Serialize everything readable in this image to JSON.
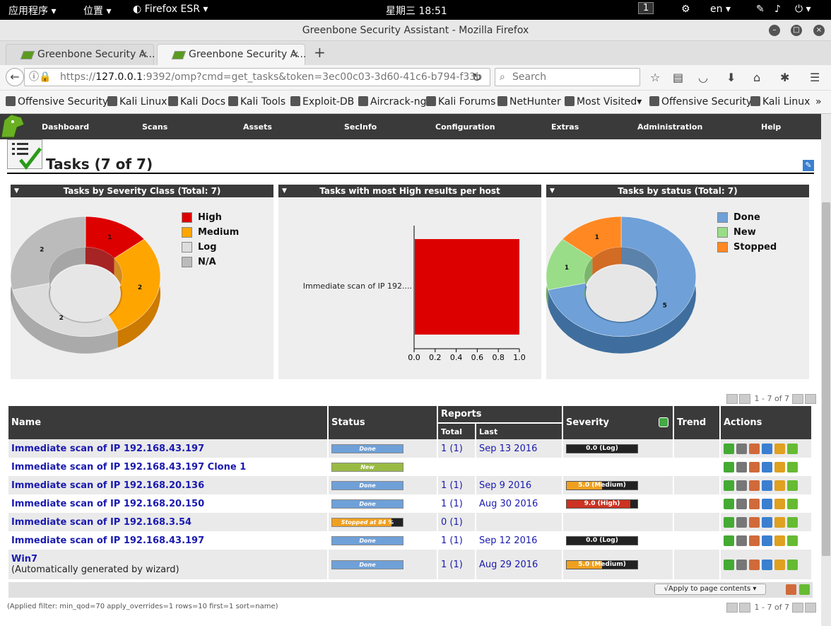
{
  "system": {
    "apps_label": "应用程序",
    "places_label": "位置",
    "browser_label": "Firefox ESR",
    "clock": "星期三 18:51",
    "workspace": "1",
    "lang": "en"
  },
  "window": {
    "title": "Greenbone Security Assistant - Mozilla Firefox"
  },
  "tabs": [
    {
      "label": "Greenbone Security A..."
    },
    {
      "label": "Greenbone Security A..."
    }
  ],
  "nav": {
    "url_prefix": "https://",
    "url_host": "127.0.0.1",
    "url_rest": ":9392/omp?cmd=get_tasks&token=3ec00c03-3d60-41c6-b794-f33b",
    "search_placeholder": "Search"
  },
  "bookmarks": [
    "Offensive Security",
    "Kali Linux",
    "Kali Docs",
    "Kali Tools",
    "Exploit-DB",
    "Aircrack-ng",
    "Kali Forums",
    "NetHunter",
    "Most Visited",
    "Offensive Security",
    "Kali Linux"
  ],
  "menu": [
    "Dashboard",
    "Scans",
    "Assets",
    "SecInfo",
    "Configuration",
    "Extras",
    "Administration",
    "Help"
  ],
  "page": {
    "title": "Tasks (7 of 7)"
  },
  "charts": {
    "severity": {
      "title": "Tasks by Severity Class (Total: 7)",
      "legend": [
        {
          "label": "High",
          "color": "#cc0000"
        },
        {
          "label": "Medium",
          "color": "#ffa500"
        },
        {
          "label": "Log",
          "color": "#dddddd"
        },
        {
          "label": "N/A",
          "color": "#bbbbbb"
        }
      ],
      "slices": [
        {
          "label": "High",
          "value": 1,
          "color": "#dd0000",
          "side": "#990000"
        },
        {
          "label": "Medium",
          "value": 2,
          "color": "#ffa500",
          "side": "#cc7a00"
        },
        {
          "label": "Log",
          "value": 2,
          "color": "#dddddd",
          "side": "#aaaaaa"
        },
        {
          "label": "N/A",
          "value": 2,
          "color": "#bbbbbb",
          "side": "#999999"
        }
      ]
    },
    "high_per_host": {
      "title": "Tasks with most High results per host",
      "bar_label": "Immediate scan of IP 192....",
      "value": 1,
      "ticks": [
        "0.0",
        "0.2",
        "0.4",
        "0.6",
        "0.8",
        "1.0"
      ],
      "color": "#dd0000"
    },
    "status": {
      "title": "Tasks by status (Total: 7)",
      "legend": [
        {
          "label": "Done",
          "color": "#6fa0d8"
        },
        {
          "label": "New",
          "color": "#99dd88"
        },
        {
          "label": "Stopped",
          "color": "#ff8822"
        }
      ],
      "slices": [
        {
          "label": "Done",
          "value": 5,
          "color": "#6fa0d8",
          "side": "#3f6e9e"
        },
        {
          "label": "New",
          "value": 1,
          "color": "#99dd88",
          "side": "#66aa55"
        },
        {
          "label": "Stopped",
          "value": 1,
          "color": "#ff8822",
          "side": "#cc5500"
        }
      ]
    }
  },
  "pager": {
    "text": "1 - 7 of 7"
  },
  "table": {
    "headers": {
      "name": "Name",
      "status": "Status",
      "reports": "Reports",
      "total": "Total",
      "last": "Last",
      "severity": "Severity",
      "trend": "Trend",
      "actions": "Actions"
    },
    "rows": [
      {
        "name": "Immediate scan of IP 192.168.43.197",
        "sub": "",
        "status": "Done",
        "status_color": "#6fa0d8",
        "progress": 1.0,
        "total": "1 (1)",
        "last": "Sep 13 2016",
        "severity": "0.0 (Log)",
        "sev_level": 0.0,
        "sev_color": "#222222"
      },
      {
        "name": "Immediate scan of IP 192.168.43.197 Clone 1",
        "sub": "",
        "status": "New",
        "status_color": "#99bb44",
        "progress": 1.0,
        "total": "",
        "last": "",
        "severity": "",
        "sev_level": 0,
        "sev_color": ""
      },
      {
        "name": "Immediate scan of IP 192.168.20.136",
        "sub": "",
        "status": "Done",
        "status_color": "#6fa0d8",
        "progress": 1.0,
        "total": "1 (1)",
        "last": "Sep 9 2016",
        "severity": "5.0 (Medium)",
        "sev_level": 0.5,
        "sev_color": "#f0a020"
      },
      {
        "name": "Immediate scan of IP 192.168.20.150",
        "sub": "",
        "status": "Done",
        "status_color": "#6fa0d8",
        "progress": 1.0,
        "total": "1 (1)",
        "last": "Aug 30 2016",
        "severity": "9.0 (High)",
        "sev_level": 0.9,
        "sev_color": "#cc3322"
      },
      {
        "name": "Immediate scan of IP 192.168.3.54",
        "sub": "",
        "status": "Stopped at 84 %",
        "status_color": "#f0a020",
        "progress": 0.84,
        "total": "0 (1)",
        "last": "",
        "severity": "",
        "sev_level": 0,
        "sev_color": ""
      },
      {
        "name": "Immediate scan of IP 192.168.43.197",
        "sub": "",
        "status": "Done",
        "status_color": "#6fa0d8",
        "progress": 1.0,
        "total": "1 (1)",
        "last": "Sep 12 2016",
        "severity": "0.0 (Log)",
        "sev_level": 0.0,
        "sev_color": "#222222"
      },
      {
        "name": "Win7",
        "sub": "(Automatically generated by wizard)",
        "status": "Done",
        "status_color": "#6fa0d8",
        "progress": 1.0,
        "total": "1 (1)",
        "last": "Aug 29 2016",
        "severity": "5.0 (Medium)",
        "sev_level": 0.5,
        "sev_color": "#f0a020"
      }
    ]
  },
  "footer": {
    "apply_label": "√Apply to page contents",
    "filter": "(Applied filter: min_qod=70 apply_overrides=1 rows=10 first=1 sort=name)"
  }
}
